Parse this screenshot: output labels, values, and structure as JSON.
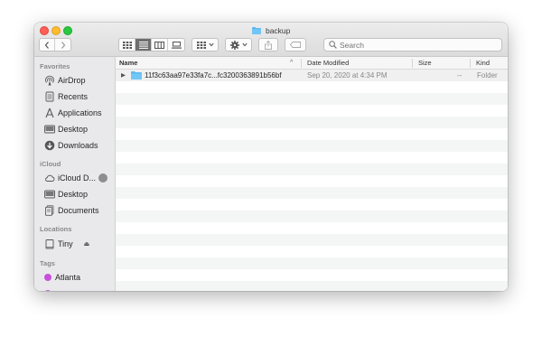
{
  "window": {
    "title": "backup",
    "nav": {
      "back_icon": "chevron-left-icon",
      "forward_icon": "chevron-right-icon"
    },
    "view_modes": [
      "icon-view-icon",
      "list-view-icon",
      "column-view-icon",
      "gallery-view-icon"
    ],
    "active_view": "list",
    "search": {
      "placeholder": "Search",
      "value": ""
    }
  },
  "sidebar": {
    "sections": [
      {
        "heading": "Favorites",
        "items": [
          "AirDrop",
          "Recents",
          "Applications",
          "Desktop",
          "Downloads"
        ]
      },
      {
        "heading": "iCloud",
        "items": [
          "iCloud D...",
          "Desktop",
          "Documents"
        ]
      },
      {
        "heading": "Locations",
        "items": [
          "Tiny"
        ]
      },
      {
        "heading": "Tags",
        "items": [
          "Atlanta"
        ]
      }
    ],
    "tag_colors": {
      "Atlanta": "#c84fdc"
    }
  },
  "file_list": {
    "columns": [
      "Name",
      "Date Modified",
      "Size",
      "Kind"
    ],
    "sort_indicator": "^",
    "rows": [
      {
        "name": "11f3c63aa97e33fa7c...fc3200363891b56bf",
        "date_modified": "Sep 20, 2020 at 4:34 PM",
        "size": "--",
        "kind": "Folder"
      }
    ]
  },
  "colors": {
    "folder_blue": "#5ab8f0",
    "close": "#fe5f57",
    "minimize": "#febc2e",
    "maximize": "#28c840"
  }
}
